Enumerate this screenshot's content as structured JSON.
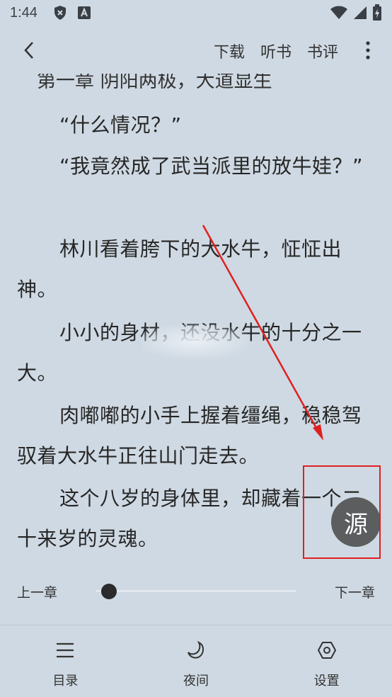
{
  "status_bar": {
    "time": "1:44",
    "icons": [
      "shield-icon",
      "font-a-icon",
      "wifi-icon",
      "signal-icon",
      "battery-icon"
    ]
  },
  "toolbar": {
    "download_label": "下载",
    "listen_label": "听书",
    "review_label": "书评"
  },
  "content": {
    "chapter_title": "第一章 阴阳两极，大道显生",
    "paragraphs": [
      "“什么情况？”",
      "“我竟然成了武当派里的放牛娃？”",
      "林川看着胯下的大水牛，怔怔出神。",
      "小小的身材，还没水牛的十分之一大。",
      "肉嘟嘟的小手上握着缰绳，稳稳驾驭着大水牛正往山门走去。",
      "这个八岁的身体里，却藏着一个二十来岁的灵魂。"
    ]
  },
  "source_button": {
    "label": "源"
  },
  "progress": {
    "prev_label": "上一章",
    "next_label": "下一章",
    "value": 0.05
  },
  "bottom_nav": {
    "items": [
      {
        "label": "目录",
        "icon": "menu-list-icon"
      },
      {
        "label": "夜间",
        "icon": "moon-icon"
      },
      {
        "label": "设置",
        "icon": "settings-hexagon-icon"
      }
    ]
  },
  "colors": {
    "background": "#cfd9e3",
    "annotation": "#e02020",
    "source_button": "#5b5d5f"
  }
}
